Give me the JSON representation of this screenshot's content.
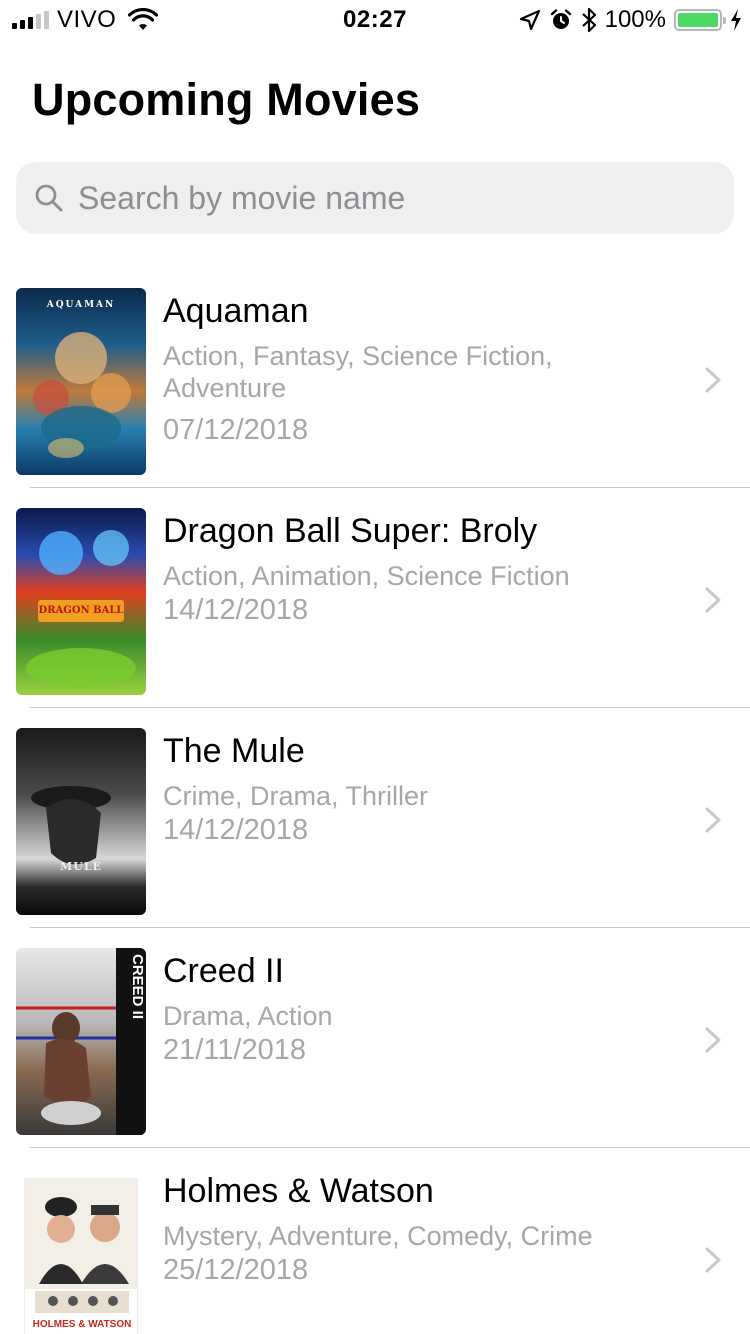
{
  "status_bar": {
    "carrier": "VIVO",
    "time": "02:27",
    "battery_percent": "100%",
    "battery_level": 1.0,
    "icons": [
      "signal-icon",
      "wifi-icon",
      "location-arrow-icon",
      "alarm-icon",
      "bluetooth-icon",
      "battery-icon",
      "charging-bolt-icon"
    ]
  },
  "header": {
    "title": "Upcoming Movies"
  },
  "search": {
    "placeholder": "Search by movie name",
    "value": "",
    "icon": "search-icon"
  },
  "movies": [
    {
      "title": "Aquaman",
      "genres": "Action, Fantasy, Science Fiction, Adventure",
      "date": "07/12/2018",
      "poster_text": "AQUAMAN"
    },
    {
      "title": "Dragon Ball Super: Broly",
      "genres": "Action, Animation, Science Fiction",
      "date": "14/12/2018",
      "poster_text": "DRAGON BALL"
    },
    {
      "title": "The Mule",
      "genres": "Crime, Drama, Thriller",
      "date": "14/12/2018",
      "poster_text": "MULE"
    },
    {
      "title": "Creed II",
      "genres": "Drama, Action",
      "date": "21/11/2018",
      "poster_text": "CREED II"
    },
    {
      "title": "Holmes & Watson",
      "genres": "Mystery, Adventure, Comedy, Crime",
      "date": "25/12/2018",
      "poster_text": "HOLMES & WATSON"
    }
  ],
  "colors": {
    "accent": "#000000",
    "secondary_text": "#a7a7ab",
    "search_background": "#efeff0",
    "battery_green": "#4cd964"
  }
}
